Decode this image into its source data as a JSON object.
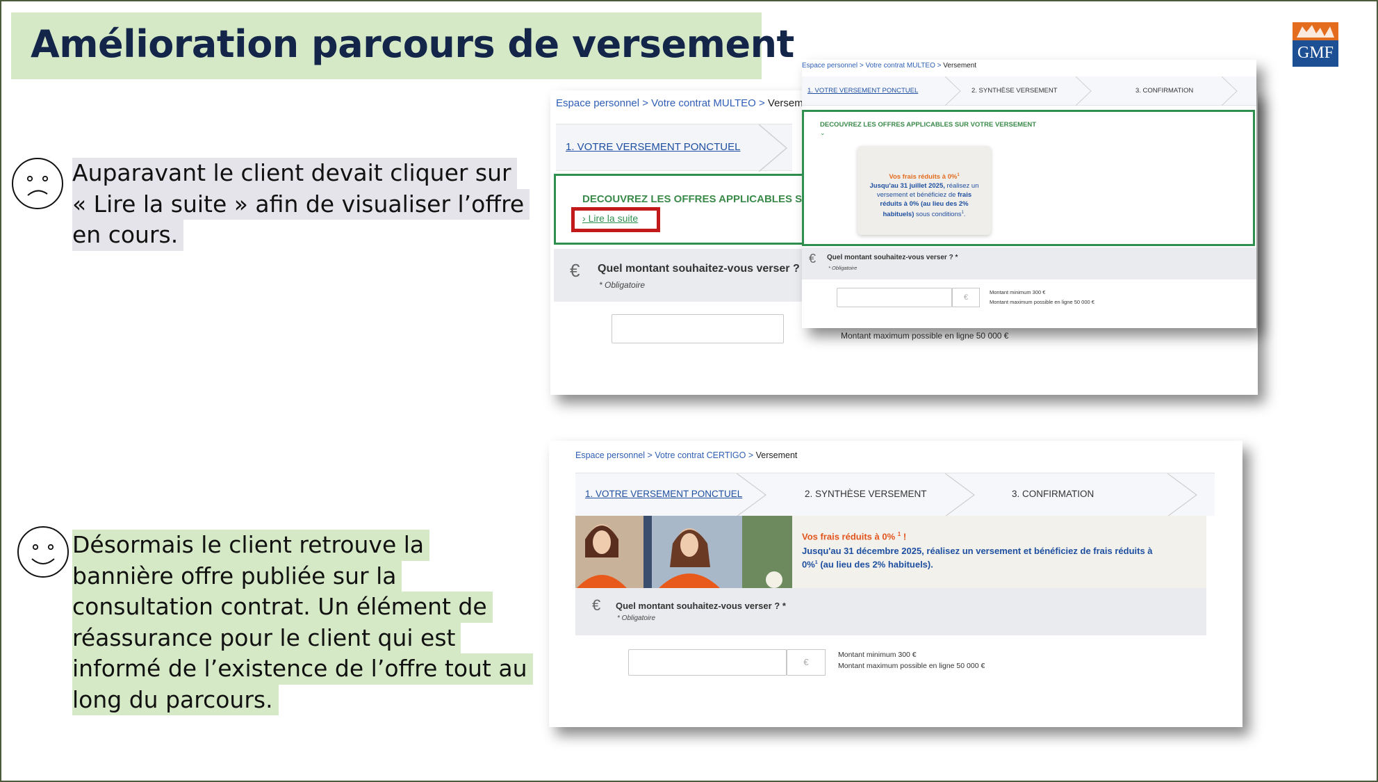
{
  "title": "Amélioration parcours de versement",
  "logo": {
    "text": "GMF",
    "colors": {
      "top": "#e36c1f",
      "bottom": "#1c4f93"
    }
  },
  "before": {
    "lines": [
      "Auparavant le client devait cliquer sur",
      "« Lire la suite » afin de visualiser l’offre",
      "en cours."
    ]
  },
  "after": {
    "lines": [
      "Désormais le client retrouve la",
      "bannière offre publiée sur la",
      "consultation contrat. Un élément de",
      "réassurance pour le client qui est",
      "informé de l’existence de l’offre tout au",
      "long du parcours."
    ]
  },
  "shot_old": {
    "crumb_prefix": "Espace personnel > Votre contrat MULTEO > ",
    "crumb_current": "Versement",
    "step1": "1. VOTRE VERSEMENT PONCTUEL",
    "offer_title": "DECOUVREZ LES OFFRES APPLICABLES SUR V",
    "read_more": "Lire la suite",
    "question": "Quel montant souhaitez-vous verser ?",
    "required": "* Obligatoire",
    "euro": "€",
    "max": "Montant maximum possible en ligne 50 000 €"
  },
  "shot_old_b": {
    "crumb_prefix": "Espace personnel > Votre contrat MULTEO > ",
    "crumb_current": "Versement",
    "step1": "1. VOTRE VERSEMENT PONCTUEL",
    "step2": "2. SYNTHÈSE VERSEMENT",
    "step3": "3. CONFIRMATION",
    "offer_title": "DECOUVREZ LES OFFRES APPLICABLES SUR VOTRE VERSEMENT",
    "card_title": "Vos frais réduits à 0%",
    "card_line1_bold": "Jusqu'au 31 juillet 2025,",
    "card_line1_rest": " réalisez un",
    "card_line2": "versement et bénéficiez de ",
    "card_line2_bold": "frais",
    "card_line3_bold": "réduits à 0% (au lieu des 2%",
    "card_line4_bold": "habituels)",
    "card_line4_rest": " sous conditions",
    "question": "Quel montant souhaitez-vous verser ? *",
    "required": "* Obligatoire",
    "euro": "€",
    "min": "Montant minimum 300 €",
    "max": "Montant maximum possible en ligne 50 000 €"
  },
  "shot_new": {
    "crumb_prefix": "Espace personnel > Votre contrat CERTIGO > ",
    "crumb_current": "Versement",
    "step1": "1. VOTRE VERSEMENT PONCTUEL",
    "step2": "2. SYNTHÈSE VERSEMENT",
    "step3": "3. CONFIRMATION",
    "banner_title": "Vos frais réduits à 0% ",
    "banner_sup": "1",
    "banner_title_end": " !",
    "banner_line1": "Jusqu'au 31 décembre 2025, réalisez un versement et bénéficiez de frais réduits à",
    "banner_line2": "0%",
    "banner_line2_rest": " (au lieu des 2% habituels).",
    "question": "Quel montant souhaitez-vous verser ? *",
    "required": "* Obligatoire",
    "euro": "€",
    "min": "Montant minimum 300 €",
    "max": "Montant maximum possible en ligne 50 000 €"
  }
}
